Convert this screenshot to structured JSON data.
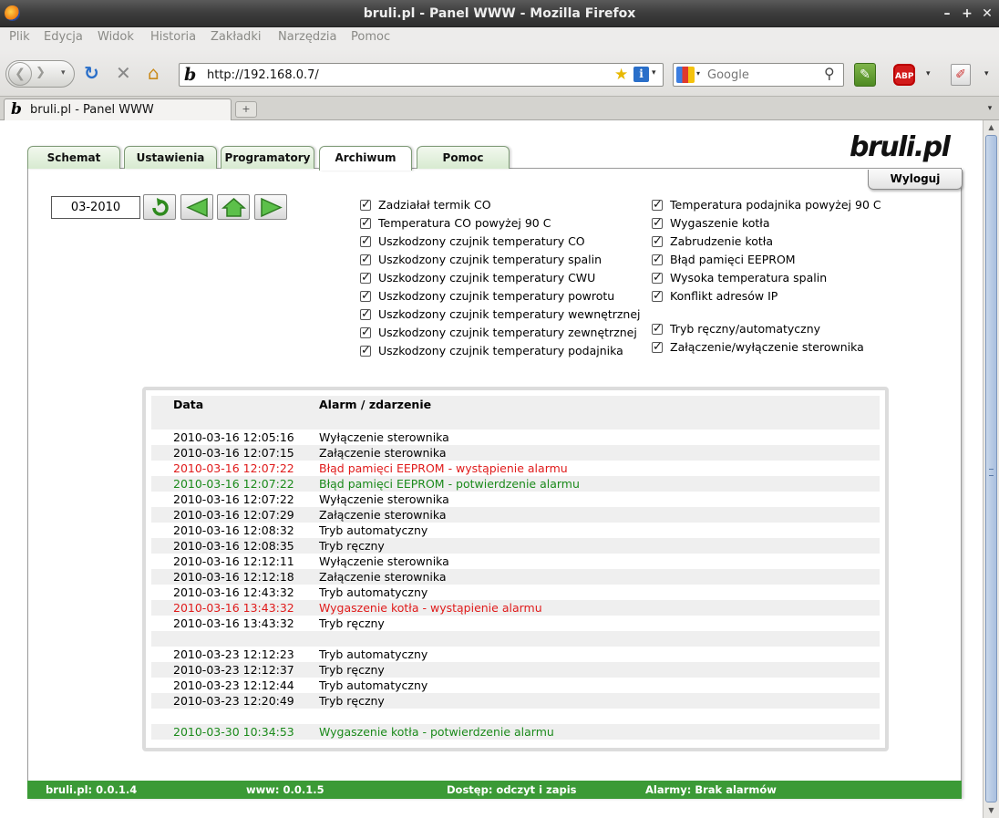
{
  "window": {
    "title": "bruli.pl - Panel WWW - Mozilla Firefox"
  },
  "menu": [
    "Plik",
    "Edycja",
    "Widok",
    "Historia",
    "Zakładki",
    "Narzędzia",
    "Pomoc"
  ],
  "nav": {
    "url": "http://192.168.0.7/",
    "search_placeholder": "Google",
    "abp_label": "ABP"
  },
  "browser_tab": {
    "label": "bruli.pl - Panel WWW"
  },
  "page": {
    "logo": "bruli.pl",
    "tabs": [
      "Schemat",
      "Ustawienia",
      "Programatory",
      "Archiwum",
      "Pomoc"
    ],
    "active_tab": "Archiwum",
    "logout_label": "Wyloguj",
    "month": "03-2010"
  },
  "filters": {
    "left": [
      "Zadziałał termik CO",
      "Temperatura CO powyżej 90 C",
      "Uszkodzony czujnik temperatury CO",
      "Uszkodzony czujnik temperatury spalin",
      "Uszkodzony czujnik temperatury CWU",
      "Uszkodzony czujnik temperatury powrotu",
      "Uszkodzony czujnik temperatury wewnętrznej",
      "Uszkodzony czujnik temperatury zewnętrznej",
      "Uszkodzony czujnik temperatury podajnika"
    ],
    "right": [
      "Temperatura podajnika powyżej 90 C",
      "Wygaszenie kotła",
      "Zabrudzenie kotła",
      "Błąd pamięci EEPROM",
      "Wysoka temperatura spalin",
      "Konflikt adresów IP"
    ],
    "right2": [
      "Tryb ręczny/automatyczny",
      "Załączenie/wyłączenie sterownika"
    ]
  },
  "log": {
    "header": {
      "date": "Data",
      "event": "Alarm / zdarzenie"
    },
    "rows": [
      {
        "date": "",
        "event": "",
        "type": "normal"
      },
      {
        "date": "2010-03-16 12:05:16",
        "event": "Wyłączenie sterownika",
        "type": "normal"
      },
      {
        "date": "2010-03-16 12:07:15",
        "event": "Załączenie sterownika",
        "type": "normal"
      },
      {
        "date": "2010-03-16 12:07:22",
        "event": "Błąd pamięci EEPROM - wystąpienie alarmu",
        "type": "alarm"
      },
      {
        "date": "2010-03-16 12:07:22",
        "event": "Błąd pamięci EEPROM - potwierdzenie alarmu",
        "type": "ack"
      },
      {
        "date": "2010-03-16 12:07:22",
        "event": "Wyłączenie sterownika",
        "type": "normal"
      },
      {
        "date": "2010-03-16 12:07:29",
        "event": "Załączenie sterownika",
        "type": "normal"
      },
      {
        "date": "2010-03-16 12:08:32",
        "event": "Tryb automatyczny",
        "type": "normal"
      },
      {
        "date": "2010-03-16 12:08:35",
        "event": "Tryb ręczny",
        "type": "normal"
      },
      {
        "date": "2010-03-16 12:12:11",
        "event": "Wyłączenie sterownika",
        "type": "normal"
      },
      {
        "date": "2010-03-16 12:12:18",
        "event": "Załączenie sterownika",
        "type": "normal"
      },
      {
        "date": "2010-03-16 12:43:32",
        "event": "Tryb automatyczny",
        "type": "normal"
      },
      {
        "date": "2010-03-16 13:43:32",
        "event": "Wygaszenie kotła - wystąpienie alarmu",
        "type": "alarm"
      },
      {
        "date": "2010-03-16 13:43:32",
        "event": "Tryb ręczny",
        "type": "normal"
      },
      {
        "date": "",
        "event": "",
        "type": "normal"
      },
      {
        "date": "2010-03-23 12:12:23",
        "event": "Tryb automatyczny",
        "type": "normal"
      },
      {
        "date": "2010-03-23 12:12:37",
        "event": "Tryb ręczny",
        "type": "normal"
      },
      {
        "date": "2010-03-23 12:12:44",
        "event": "Tryb automatyczny",
        "type": "normal"
      },
      {
        "date": "2010-03-23 12:20:49",
        "event": "Tryb ręczny",
        "type": "normal"
      },
      {
        "date": "",
        "event": "",
        "type": "normal"
      },
      {
        "date": "2010-03-30 10:34:53",
        "event": "Wygaszenie kotła - potwierdzenie alarmu",
        "type": "ack"
      }
    ]
  },
  "status": {
    "version": "bruli.pl: 0.0.1.4",
    "www": "www: 0.0.1.5",
    "access": "Dostęp: odczyt i zapis",
    "alarms": "Alarmy: Brak alarmów"
  },
  "colors": {
    "alarm": "#e01b1b",
    "ack": "#1b8a1b",
    "statusbar": "#3b9a36"
  }
}
